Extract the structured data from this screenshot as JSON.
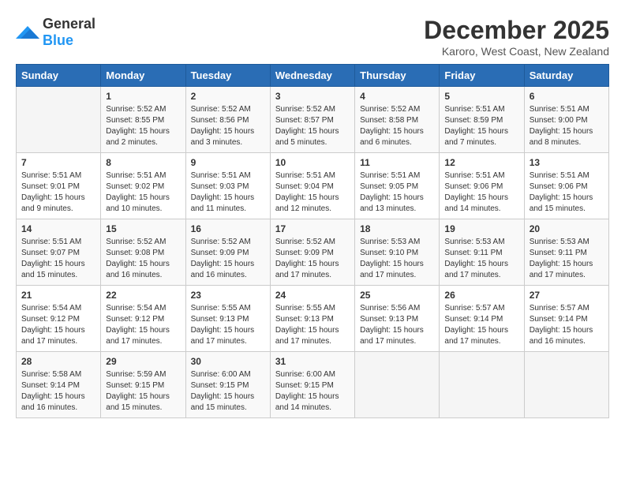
{
  "logo": {
    "text_general": "General",
    "text_blue": "Blue"
  },
  "title": {
    "month_year": "December 2025",
    "location": "Karoro, West Coast, New Zealand"
  },
  "weekdays": [
    "Sunday",
    "Monday",
    "Tuesday",
    "Wednesday",
    "Thursday",
    "Friday",
    "Saturday"
  ],
  "weeks": [
    [
      {
        "day": "",
        "content": ""
      },
      {
        "day": "1",
        "content": "Sunrise: 5:52 AM\nSunset: 8:55 PM\nDaylight: 15 hours\nand 2 minutes."
      },
      {
        "day": "2",
        "content": "Sunrise: 5:52 AM\nSunset: 8:56 PM\nDaylight: 15 hours\nand 3 minutes."
      },
      {
        "day": "3",
        "content": "Sunrise: 5:52 AM\nSunset: 8:57 PM\nDaylight: 15 hours\nand 5 minutes."
      },
      {
        "day": "4",
        "content": "Sunrise: 5:52 AM\nSunset: 8:58 PM\nDaylight: 15 hours\nand 6 minutes."
      },
      {
        "day": "5",
        "content": "Sunrise: 5:51 AM\nSunset: 8:59 PM\nDaylight: 15 hours\nand 7 minutes."
      },
      {
        "day": "6",
        "content": "Sunrise: 5:51 AM\nSunset: 9:00 PM\nDaylight: 15 hours\nand 8 minutes."
      }
    ],
    [
      {
        "day": "7",
        "content": "Sunrise: 5:51 AM\nSunset: 9:01 PM\nDaylight: 15 hours\nand 9 minutes."
      },
      {
        "day": "8",
        "content": "Sunrise: 5:51 AM\nSunset: 9:02 PM\nDaylight: 15 hours\nand 10 minutes."
      },
      {
        "day": "9",
        "content": "Sunrise: 5:51 AM\nSunset: 9:03 PM\nDaylight: 15 hours\nand 11 minutes."
      },
      {
        "day": "10",
        "content": "Sunrise: 5:51 AM\nSunset: 9:04 PM\nDaylight: 15 hours\nand 12 minutes."
      },
      {
        "day": "11",
        "content": "Sunrise: 5:51 AM\nSunset: 9:05 PM\nDaylight: 15 hours\nand 13 minutes."
      },
      {
        "day": "12",
        "content": "Sunrise: 5:51 AM\nSunset: 9:06 PM\nDaylight: 15 hours\nand 14 minutes."
      },
      {
        "day": "13",
        "content": "Sunrise: 5:51 AM\nSunset: 9:06 PM\nDaylight: 15 hours\nand 15 minutes."
      }
    ],
    [
      {
        "day": "14",
        "content": "Sunrise: 5:51 AM\nSunset: 9:07 PM\nDaylight: 15 hours\nand 15 minutes."
      },
      {
        "day": "15",
        "content": "Sunrise: 5:52 AM\nSunset: 9:08 PM\nDaylight: 15 hours\nand 16 minutes."
      },
      {
        "day": "16",
        "content": "Sunrise: 5:52 AM\nSunset: 9:09 PM\nDaylight: 15 hours\nand 16 minutes."
      },
      {
        "day": "17",
        "content": "Sunrise: 5:52 AM\nSunset: 9:09 PM\nDaylight: 15 hours\nand 17 minutes."
      },
      {
        "day": "18",
        "content": "Sunrise: 5:53 AM\nSunset: 9:10 PM\nDaylight: 15 hours\nand 17 minutes."
      },
      {
        "day": "19",
        "content": "Sunrise: 5:53 AM\nSunset: 9:11 PM\nDaylight: 15 hours\nand 17 minutes."
      },
      {
        "day": "20",
        "content": "Sunrise: 5:53 AM\nSunset: 9:11 PM\nDaylight: 15 hours\nand 17 minutes."
      }
    ],
    [
      {
        "day": "21",
        "content": "Sunrise: 5:54 AM\nSunset: 9:12 PM\nDaylight: 15 hours\nand 17 minutes."
      },
      {
        "day": "22",
        "content": "Sunrise: 5:54 AM\nSunset: 9:12 PM\nDaylight: 15 hours\nand 17 minutes."
      },
      {
        "day": "23",
        "content": "Sunrise: 5:55 AM\nSunset: 9:13 PM\nDaylight: 15 hours\nand 17 minutes."
      },
      {
        "day": "24",
        "content": "Sunrise: 5:55 AM\nSunset: 9:13 PM\nDaylight: 15 hours\nand 17 minutes."
      },
      {
        "day": "25",
        "content": "Sunrise: 5:56 AM\nSunset: 9:13 PM\nDaylight: 15 hours\nand 17 minutes."
      },
      {
        "day": "26",
        "content": "Sunrise: 5:57 AM\nSunset: 9:14 PM\nDaylight: 15 hours\nand 17 minutes."
      },
      {
        "day": "27",
        "content": "Sunrise: 5:57 AM\nSunset: 9:14 PM\nDaylight: 15 hours\nand 16 minutes."
      }
    ],
    [
      {
        "day": "28",
        "content": "Sunrise: 5:58 AM\nSunset: 9:14 PM\nDaylight: 15 hours\nand 16 minutes."
      },
      {
        "day": "29",
        "content": "Sunrise: 5:59 AM\nSunset: 9:15 PM\nDaylight: 15 hours\nand 15 minutes."
      },
      {
        "day": "30",
        "content": "Sunrise: 6:00 AM\nSunset: 9:15 PM\nDaylight: 15 hours\nand 15 minutes."
      },
      {
        "day": "31",
        "content": "Sunrise: 6:00 AM\nSunset: 9:15 PM\nDaylight: 15 hours\nand 14 minutes."
      },
      {
        "day": "",
        "content": ""
      },
      {
        "day": "",
        "content": ""
      },
      {
        "day": "",
        "content": ""
      }
    ]
  ]
}
